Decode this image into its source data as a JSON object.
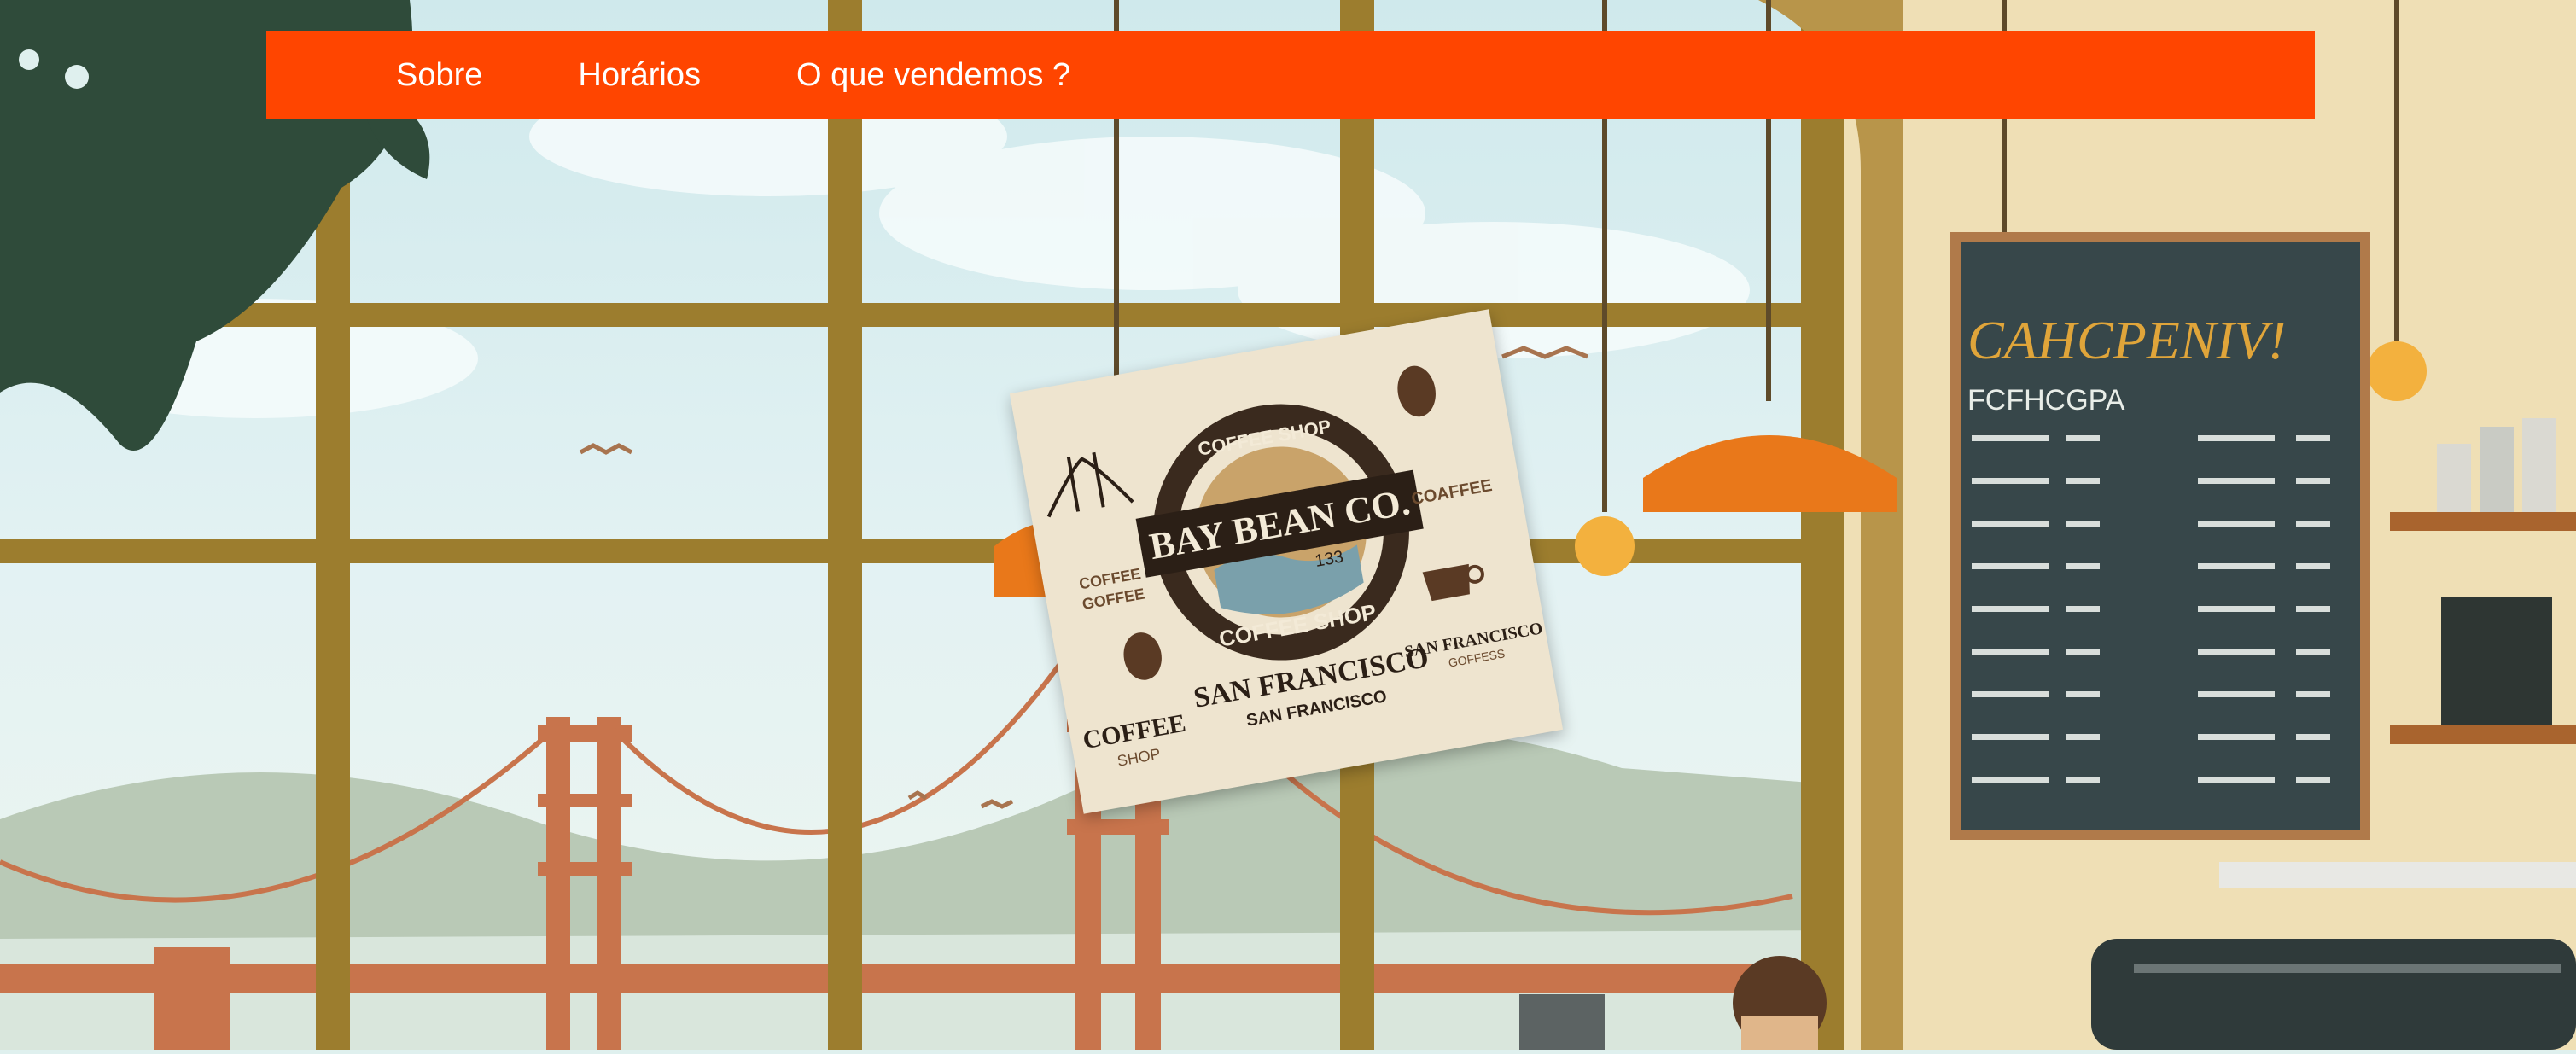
{
  "nav": {
    "items": [
      {
        "label": "Sobre"
      },
      {
        "label": "Horários"
      },
      {
        "label": "O que vendemos ?"
      }
    ]
  },
  "logo": {
    "name": "BAY BEAN CO.",
    "ring_top": "COFFEE SHOP",
    "ring_bottom": "COFFEE SHOP",
    "city_line": "SAN FRANCISCO",
    "sub_city": "SAN FRANCISCO",
    "number": "133",
    "left_text_1": "COFFEE",
    "left_text_2": "GOFFEE",
    "right_text_1": "COAFFEE",
    "right_text_2": "SAN FRANCISCO",
    "right_text_3": "GOFFESS",
    "bottom_left_1": "COFFEE",
    "bottom_left_2": "SHOP"
  },
  "chalkboard": {
    "title": "CAHCPENIV!",
    "subtitle": "FCFHCGPA"
  },
  "colors": {
    "navbar": "#ff4500",
    "nav_text": "#ffffff",
    "window_frame": "#9c7d2e",
    "lamp": "#e9781a",
    "chalkboard": "#37474a",
    "bridge": "#c8744c"
  }
}
